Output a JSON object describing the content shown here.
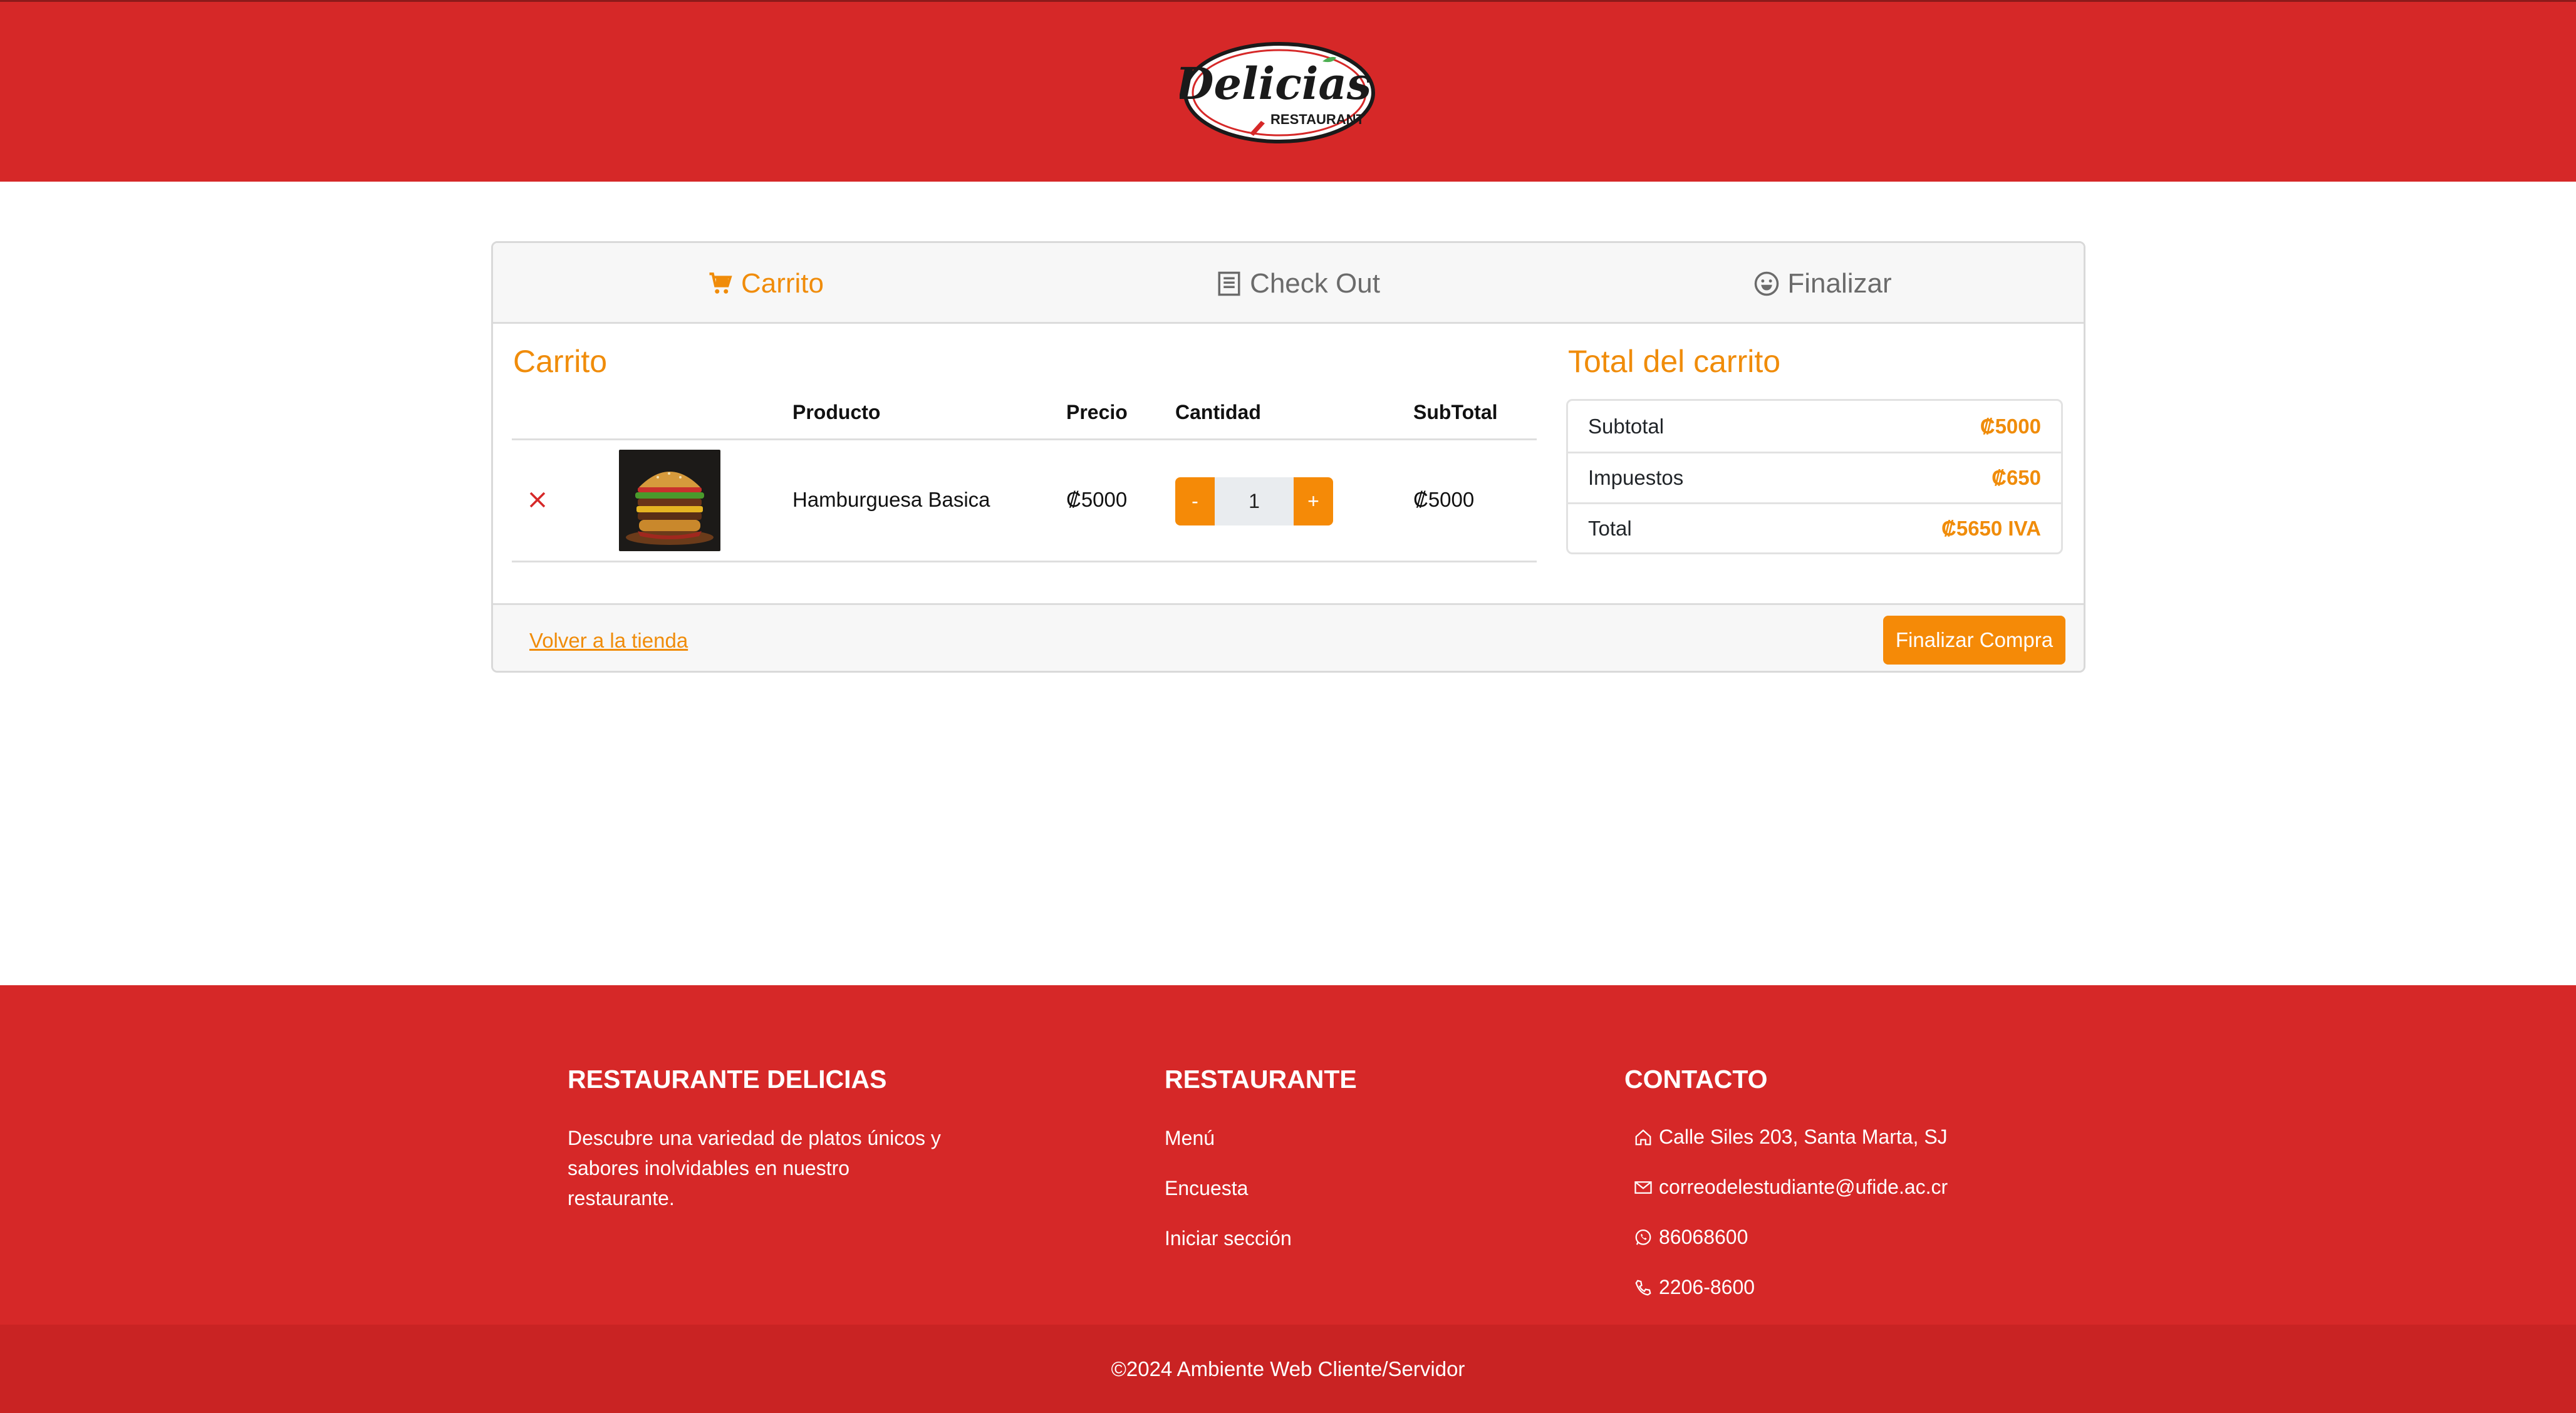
{
  "brand": {
    "logo_script": "Delicias",
    "logo_subtitle": "RESTAURANT",
    "colors": {
      "header": "#d62828",
      "accent": "#f58a07",
      "accent_text": "#f08c0a",
      "remove": "#d62828"
    }
  },
  "tabs": [
    {
      "label": "Carrito",
      "icon": "cart-icon",
      "active": true
    },
    {
      "label": "Check Out",
      "icon": "receipt-icon",
      "active": false
    },
    {
      "label": "Finalizar",
      "icon": "smile-icon",
      "active": false
    }
  ],
  "cart": {
    "title": "Carrito",
    "columns": [
      "Producto",
      "Precio",
      "Cantidad",
      "SubTotal"
    ],
    "items": [
      {
        "product": "Hamburguesa Basica",
        "price": "₡5000",
        "quantity": "1",
        "subtotal": "₡5000",
        "minus_label": "-",
        "plus_label": "+"
      }
    ]
  },
  "totals": {
    "title": "Total del carrito",
    "rows": [
      {
        "label": "Subtotal",
        "value": "₡5000"
      },
      {
        "label": "Impuestos",
        "value": "₡650"
      },
      {
        "label": "Total",
        "value": "₡5650 IVA"
      }
    ]
  },
  "actions": {
    "back_link": "Volver a la tienda",
    "finish_button": "Finalizar Compra"
  },
  "footer": {
    "about": {
      "title": "RESTAURANTE DELICIAS",
      "text": "Descubre una variedad de platos únicos y sabores inolvidables en nuestro restaurante."
    },
    "restaurant": {
      "title": "RESTAURANTE",
      "links": [
        "Menú",
        "Encuesta",
        "Iniciar sección"
      ]
    },
    "contact": {
      "title": "CONTACTO",
      "address": "Calle Siles 203, Santa Marta, SJ",
      "email": "correodelestudiante@ufide.ac.cr",
      "whatsapp": "86068600",
      "phone": "2206-8600"
    },
    "copyright": "©2024 Ambiente Web Cliente/Servidor"
  }
}
